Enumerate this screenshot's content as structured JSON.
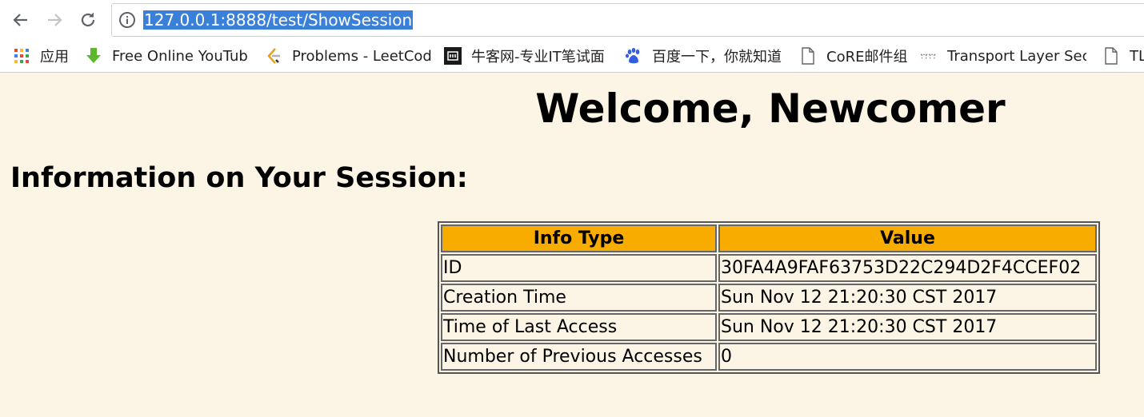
{
  "browser": {
    "url": "127.0.0.1:8888/test/ShowSession",
    "bookmarks": [
      {
        "label": "应用",
        "icon": "apps-grid-icon"
      },
      {
        "label": "Free Online YouTub",
        "icon": "download-arrow-icon"
      },
      {
        "label": "Problems - LeetCod",
        "icon": "leetcode-icon"
      },
      {
        "label": "牛客网-专业IT笔试面",
        "icon": "nowcoder-icon"
      },
      {
        "label": "百度一下，你就知道",
        "icon": "baidu-paw-icon"
      },
      {
        "label": "CoRE邮件组",
        "icon": "page-icon"
      },
      {
        "label": "Transport Layer Sec",
        "icon": "dotted-logo-icon"
      },
      {
        "label": "TL",
        "icon": "page-icon"
      }
    ],
    "colors": {
      "selection": "#3a7fd8"
    }
  },
  "page": {
    "heading": "Welcome, Newcomer",
    "subheading": "Information on Your Session:",
    "background": "#fcf4e5",
    "table": {
      "headers": [
        "Info Type",
        "Value"
      ],
      "header_color": "#f8ac00",
      "rows": [
        [
          "ID",
          "30FA4A9FAF63753D22C294D2F4CCEF02"
        ],
        [
          "Creation Time",
          "Sun Nov 12 21:20:30 CST 2017"
        ],
        [
          "Time of Last Access",
          "Sun Nov 12 21:20:30 CST 2017"
        ],
        [
          "Number of Previous Accesses",
          "0"
        ]
      ]
    }
  }
}
